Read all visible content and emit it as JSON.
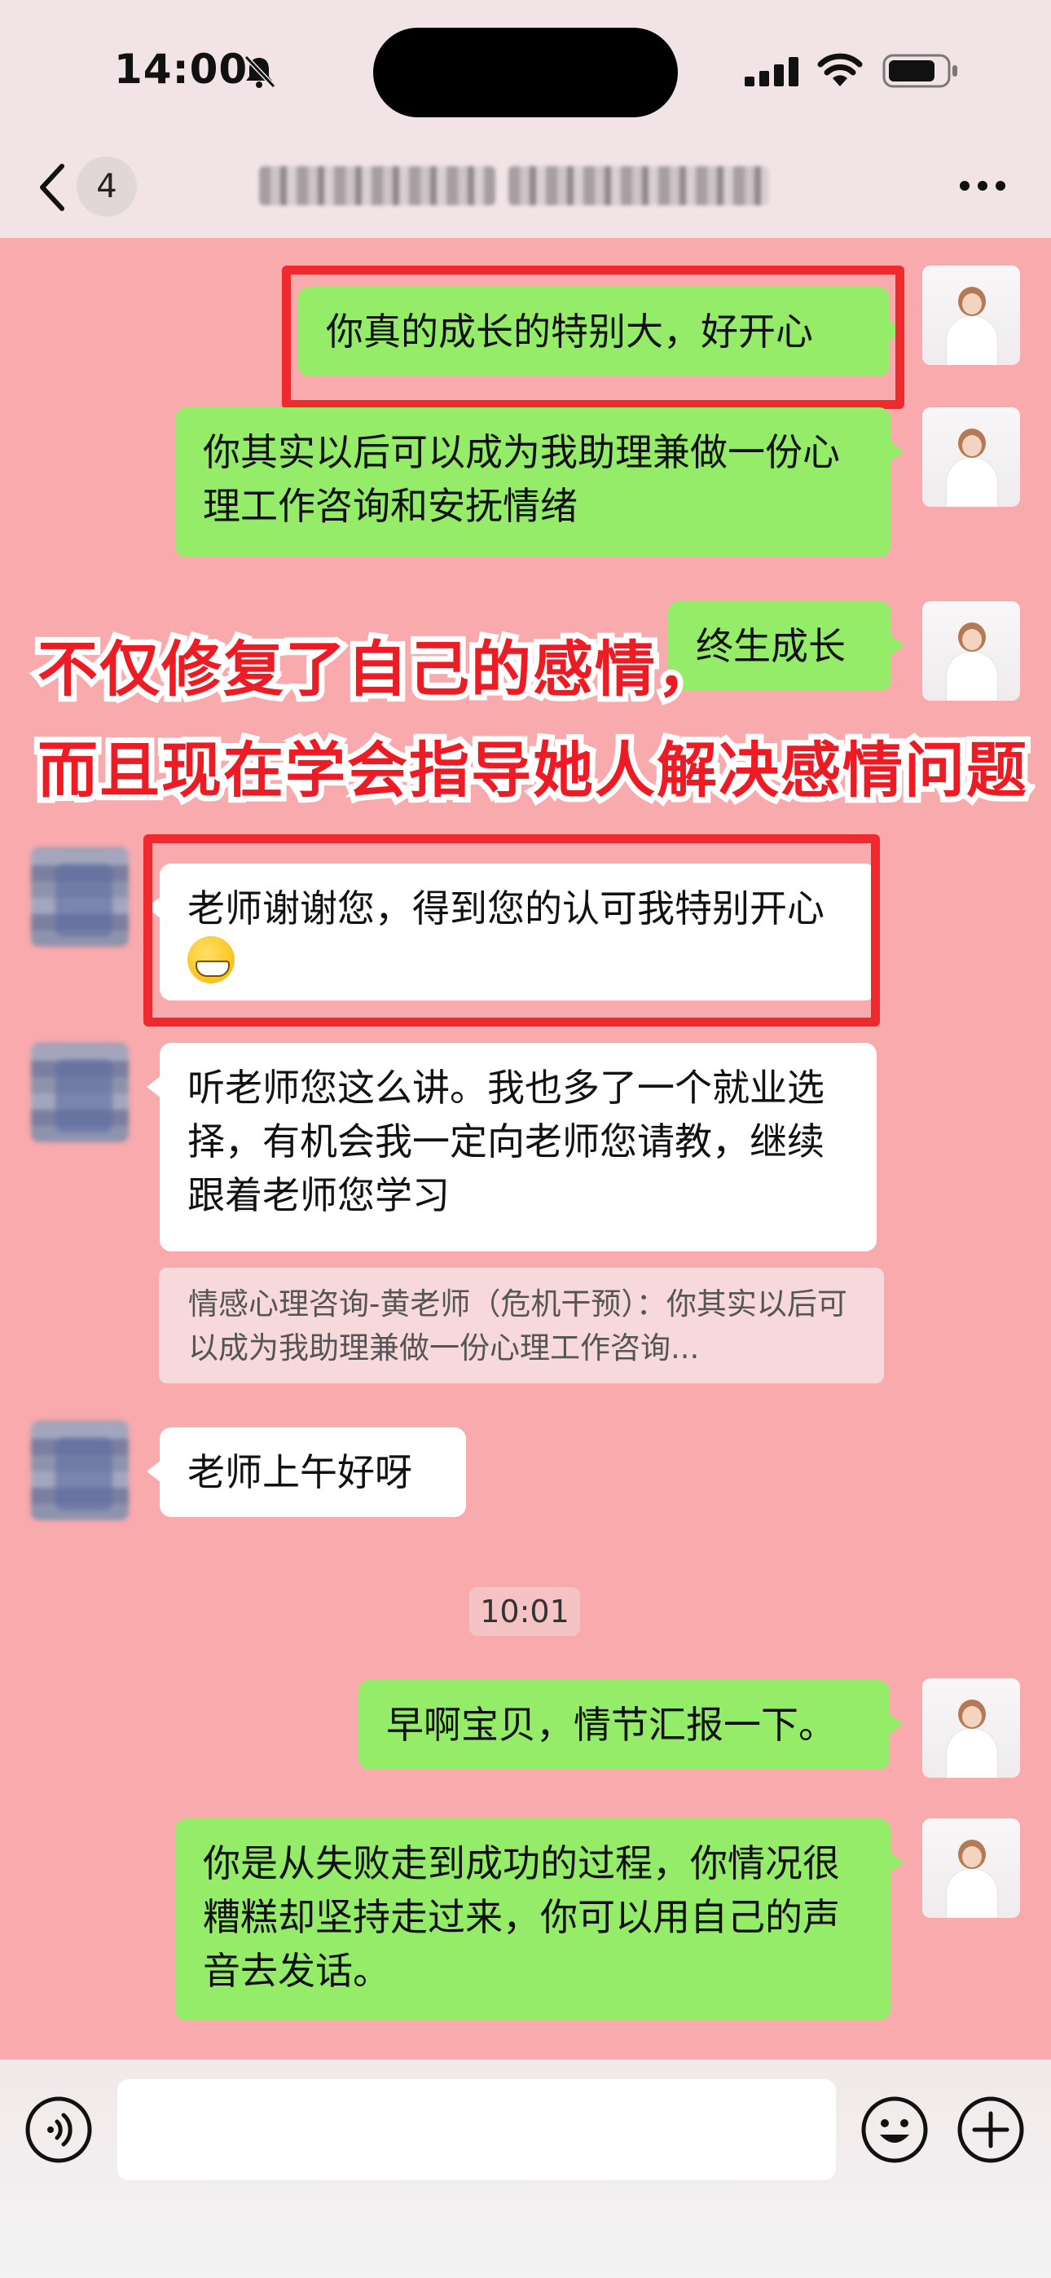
{
  "status_bar": {
    "time": "14:00",
    "icons": [
      "bell-off-icon",
      "signal-icon",
      "wifi-icon",
      "battery-icon"
    ]
  },
  "nav": {
    "unread_count": "4",
    "icons": [
      "chevron-left-icon",
      "more-icon"
    ]
  },
  "messages": [
    {
      "side": "me",
      "text": "你真的成长的特别大，好开心"
    },
    {
      "side": "me",
      "text": "你其实以后可以成为我助理兼做一份心理工作咨询和安抚情绪"
    },
    {
      "side": "me",
      "text": "终生成长"
    },
    {
      "side": "them",
      "text": "老师谢谢您，得到您的认可我特别开心",
      "emoji": "grinning-face-emoji"
    },
    {
      "side": "them",
      "text": "听老师您这么讲。我也多了一个就业选择，有机会我一定向老师您请教，继续跟着老师您学习"
    },
    {
      "side": "them",
      "text": "老师上午好呀"
    },
    {
      "side": "me",
      "text": "早啊宝贝，情节汇报一下。"
    },
    {
      "side": "me",
      "text": "你是从失败走到成功的过程，你情况很糟糕却坚持走过来，你可以用自己的声音去发话。"
    }
  ],
  "quote": {
    "text": "情感心理咨询-黄老师（危机干预）：你其实以后可以成为我助理兼做一份心理工作咨询..."
  },
  "timestamps": [
    "10:01"
  ],
  "overlay": {
    "line1": "不仅修复了自己的感情，",
    "line2": "而且现在学会指导她人解决感情问题",
    "color": "#ed1c24"
  },
  "input_bar": {
    "icons": [
      "voice-icon",
      "emoji-icon",
      "plus-icon"
    ]
  },
  "colors": {
    "background": "#f9aaad",
    "bubble_me": "#95ec69",
    "bubble_them": "#ffffff",
    "highlight_frame": "#ee2a2e"
  }
}
